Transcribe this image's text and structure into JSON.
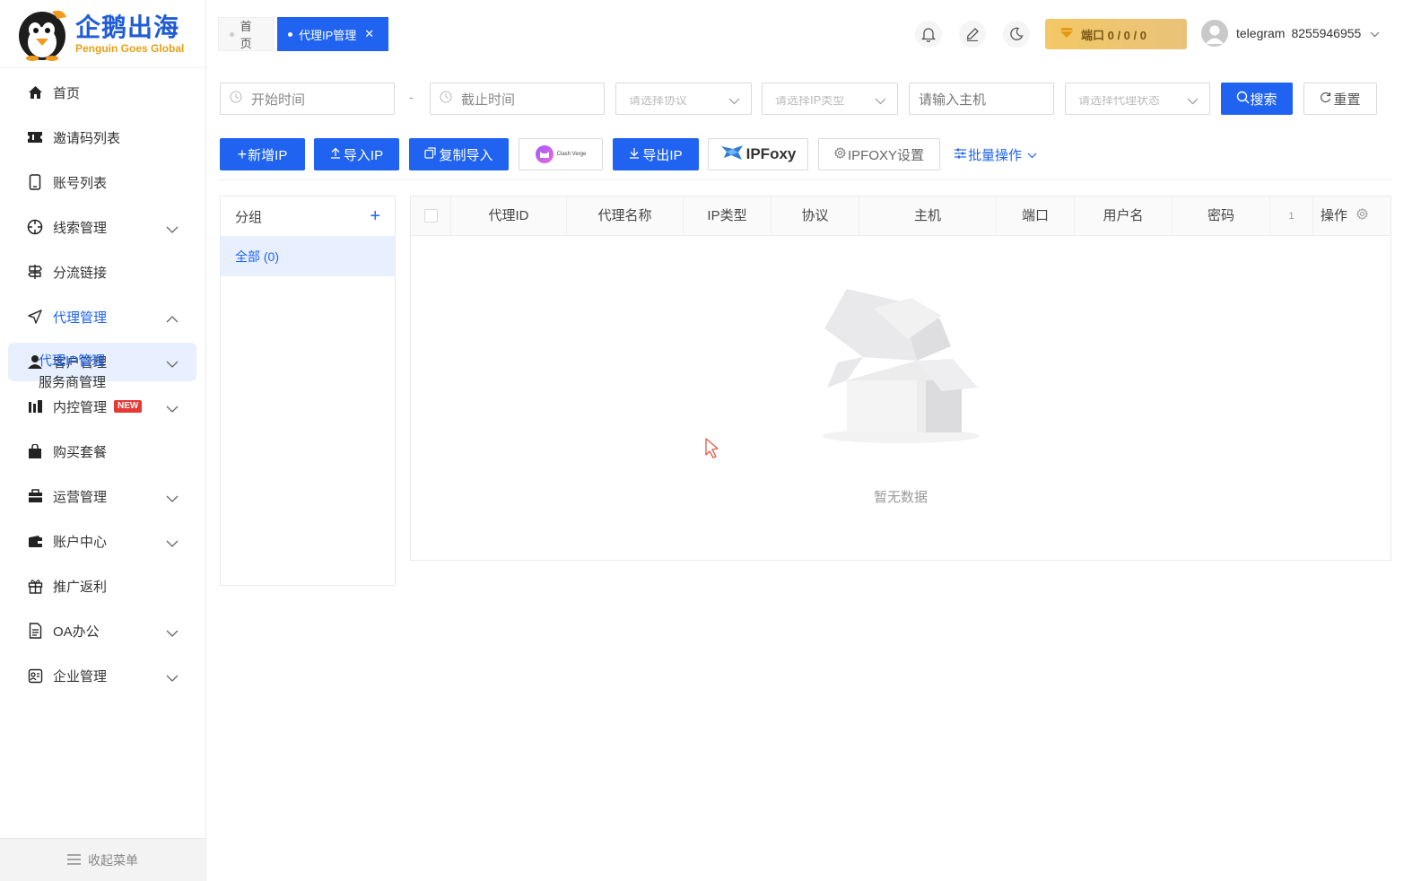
{
  "brand": {
    "name_cn": "企鹅出海",
    "name_en": "Penguin Goes Global"
  },
  "sidebar": {
    "items": [
      {
        "label": "首页",
        "icon": "home-icon"
      },
      {
        "label": "邀请码列表",
        "icon": "ticket-icon"
      },
      {
        "label": "账号列表",
        "icon": "phone-icon"
      },
      {
        "label": "线索管理",
        "icon": "target-icon"
      },
      {
        "label": "分流链接",
        "icon": "signpost-icon"
      },
      {
        "label": "代理管理",
        "icon": "send-icon"
      },
      {
        "label": "客户管理",
        "icon": "user-icon"
      },
      {
        "label": "内控管理",
        "icon": "chart-icon"
      },
      {
        "label": "购买套餐",
        "icon": "bag-icon"
      },
      {
        "label": "运营管理",
        "icon": "briefcase-icon"
      },
      {
        "label": "账户中心",
        "icon": "wallet-icon"
      },
      {
        "label": "推广返利",
        "icon": "gift-icon"
      },
      {
        "label": "OA办公",
        "icon": "document-icon"
      },
      {
        "label": "企业管理",
        "icon": "id-card-icon"
      }
    ],
    "overlay_sub": {
      "proxy_ip": "代理IP管理",
      "provider": "服务商管理"
    },
    "new_badge": "NEW",
    "collapse_label": "收起菜单"
  },
  "tabs": {
    "home": "首页",
    "active": "代理IP管理"
  },
  "header": {
    "port_label": "端口 0 / 0 / 0",
    "user_name": "telegram",
    "user_id": "8255946955"
  },
  "filters": {
    "start_time": "开始时间",
    "end_time": "截止时间",
    "dash": "-",
    "protocol_placeholder": "请选择协议",
    "ip_type_placeholder": "请选择IP类型",
    "host_placeholder": "请输入主机",
    "status_placeholder": "请选择代理状态",
    "search": "搜索",
    "reset": "重置"
  },
  "toolbar": {
    "add_ip": "新增IP",
    "import_ip": "导入IP",
    "copy_import": "复制导入",
    "clash_label": "Clash Verge",
    "export_ip": "导出IP",
    "ipfoxy_logo": "IPFoxy",
    "ipfoxy_settings": "IPFOXY设置",
    "batch_ops": "批量操作"
  },
  "groups": {
    "title": "分组",
    "all": "全部 (0)"
  },
  "table": {
    "columns": [
      "代理ID",
      "代理名称",
      "IP类型",
      "协议",
      "主机",
      "端口",
      "用户名",
      "密码",
      "1",
      "操作"
    ],
    "empty_text": "暂无数据"
  },
  "colors": {
    "primary": "#1f63f0",
    "badge": "#e53935",
    "port_gold": "#f3c865"
  }
}
